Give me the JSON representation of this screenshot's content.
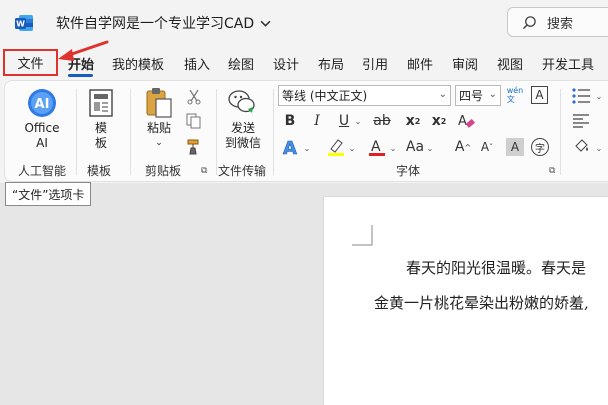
{
  "title": {
    "document_name": "软件自学网是一个专业学习CAD",
    "search_label": "搜索"
  },
  "tabs": [
    "文件",
    "开始",
    "我的模板",
    "插入",
    "绘图",
    "设计",
    "布局",
    "引用",
    "邮件",
    "审阅",
    "视图",
    "开发工具"
  ],
  "ribbon": {
    "groups": {
      "ai": {
        "label": "人工智能",
        "button": [
          "Office",
          "AI"
        ]
      },
      "template": {
        "label": "模板",
        "button": [
          "模",
          "板"
        ]
      },
      "clipboard": {
        "label": "剪贴板",
        "paste": "粘贴"
      },
      "transfer": {
        "label": "文件传输",
        "button": [
          "发送",
          "到微信"
        ]
      },
      "font": {
        "label": "字体",
        "font_name": "等线 (中文正文)",
        "font_size": "四号"
      }
    }
  },
  "tooltip": "“文件”选项卡",
  "document": {
    "line1": "春天的阳光很温暖。春天是",
    "line2": "金黄一片桃花晕染出粉嫩的娇羞,"
  },
  "colors": {
    "accent": "#185abd",
    "highlight_box": "#e0322d"
  }
}
